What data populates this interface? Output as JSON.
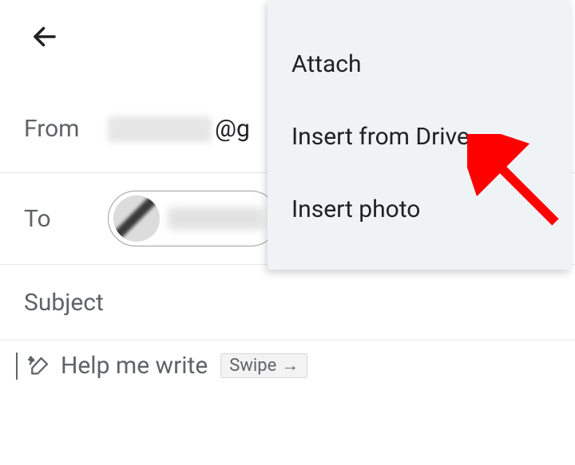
{
  "compose": {
    "from_label": "From",
    "from_domain": "@g",
    "to_label": "To",
    "subject_label": "Subject"
  },
  "help": {
    "text": "Help me write",
    "swipe_label": "Swipe"
  },
  "menu": {
    "attach": "Attach",
    "insert_drive": "Insert from Drive",
    "insert_photo": "Insert photo"
  }
}
